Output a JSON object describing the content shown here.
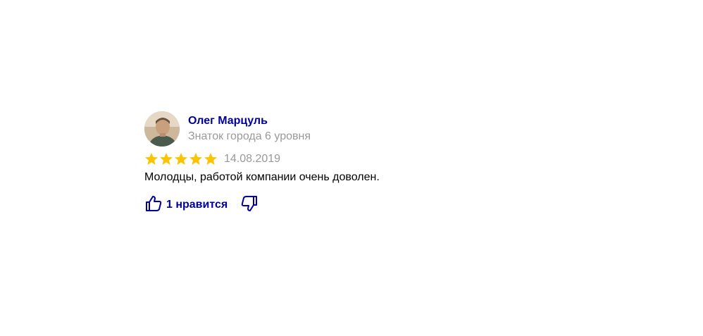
{
  "review": {
    "author_name": "Олег Марцуль",
    "author_level": "Знаток города 6 уровня",
    "rating": 5,
    "rating_max": 5,
    "date": "14.08.2019",
    "text": "Молодцы, работой компании очень доволен.",
    "like_label": "1 нравится",
    "like_count": 1
  },
  "colors": {
    "link": "#00009a",
    "muted": "#999999",
    "star": "#fcc400"
  },
  "icons": {
    "avatar": "user-avatar",
    "star": "star-icon",
    "like": "thumbs-up-icon",
    "dislike": "thumbs-down-icon"
  }
}
